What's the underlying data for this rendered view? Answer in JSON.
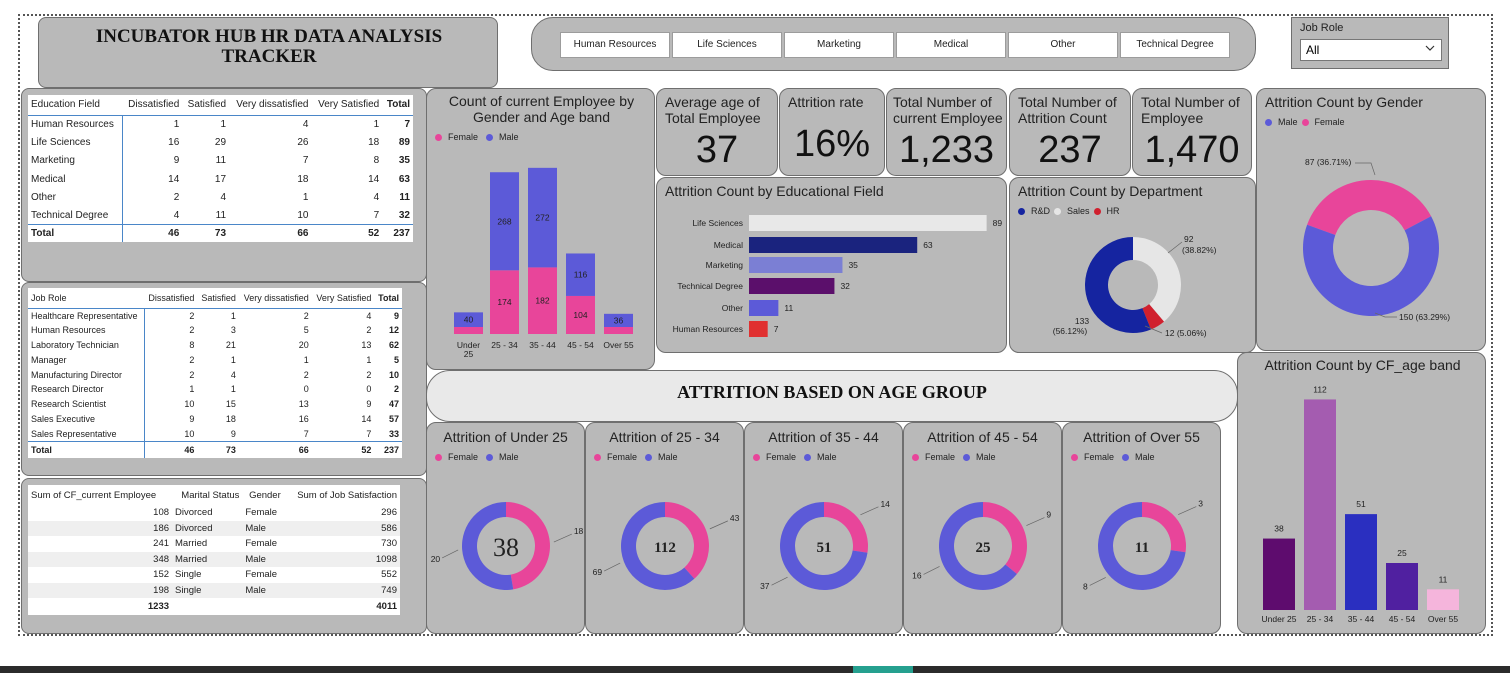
{
  "title": "INCUBATOR HUB HR DATA ANALYSIS TRACKER",
  "title_lines": [
    "INCUBATOR HUB HR DATA ANALYSIS",
    "TRACKER"
  ],
  "slicer": {
    "items": [
      "Human Resources",
      "Life Sciences",
      "Marketing",
      "Medical",
      "Other",
      "Technical Degree"
    ]
  },
  "job_role_filter": {
    "label": "Job Role",
    "value": "All",
    "icon": "chevron-down-icon"
  },
  "kpis": [
    {
      "label": "Average age of Total Employee",
      "value": "37"
    },
    {
      "label": "Attrition rate",
      "value": "16%"
    },
    {
      "label": "Total Number of current Employee",
      "value": "1,233"
    },
    {
      "label": "Total Number of Attrition Count",
      "value": "237"
    },
    {
      "label": "Total Number of Employee",
      "value": "1,470"
    }
  ],
  "edu_table": {
    "headers": [
      "Education Field",
      "Dissatisfied",
      "Satisfied",
      "Very dissatisfied",
      "Very Satisfied",
      "Total"
    ],
    "rows": [
      [
        "Human Resources",
        "1",
        "1",
        "4",
        "1",
        "7"
      ],
      [
        "Life Sciences",
        "16",
        "29",
        "26",
        "18",
        "89"
      ],
      [
        "Marketing",
        "9",
        "11",
        "7",
        "8",
        "35"
      ],
      [
        "Medical",
        "14",
        "17",
        "18",
        "14",
        "63"
      ],
      [
        "Other",
        "2",
        "4",
        "1",
        "4",
        "11"
      ],
      [
        "Technical Degree",
        "4",
        "11",
        "10",
        "7",
        "32"
      ]
    ],
    "total": [
      "Total",
      "46",
      "73",
      "66",
      "52",
      "237"
    ]
  },
  "job_table": {
    "headers": [
      "Job Role",
      "Dissatisfied",
      "Satisfied",
      "Very dissatisfied",
      "Very Satisfied",
      "Total"
    ],
    "rows": [
      [
        "Healthcare Representative",
        "2",
        "1",
        "2",
        "4",
        "9"
      ],
      [
        "Human Resources",
        "2",
        "3",
        "5",
        "2",
        "12"
      ],
      [
        "Laboratory Technician",
        "8",
        "21",
        "20",
        "13",
        "62"
      ],
      [
        "Manager",
        "2",
        "1",
        "1",
        "1",
        "5"
      ],
      [
        "Manufacturing Director",
        "2",
        "4",
        "2",
        "2",
        "10"
      ],
      [
        "Research Director",
        "1",
        "1",
        "0",
        "0",
        "2"
      ],
      [
        "Research Scientist",
        "10",
        "15",
        "13",
        "9",
        "47"
      ],
      [
        "Sales Executive",
        "9",
        "18",
        "16",
        "14",
        "57"
      ],
      [
        "Sales Representative",
        "10",
        "9",
        "7",
        "7",
        "33"
      ]
    ],
    "total": [
      "Total",
      "46",
      "73",
      "66",
      "52",
      "237"
    ]
  },
  "marital_table": {
    "headers": [
      "Sum of CF_current Employee",
      "Marital Status",
      "Gender",
      "Sum of Job Satisfaction"
    ],
    "rows": [
      [
        "108",
        "Divorced",
        "Female",
        "296"
      ],
      [
        "186",
        "Divorced",
        "Male",
        "586"
      ],
      [
        "241",
        "Married",
        "Female",
        "730"
      ],
      [
        "348",
        "Married",
        "Male",
        "1098"
      ],
      [
        "152",
        "Single",
        "Female",
        "552"
      ],
      [
        "198",
        "Single",
        "Male",
        "749"
      ]
    ],
    "total": [
      "1233",
      "",
      "",
      "4011"
    ]
  },
  "colors": {
    "female": "#e8459a",
    "male": "#5c5ad8",
    "panel": "#b9b9b9"
  },
  "banner": "ATTRITION BASED ON AGE GROUP",
  "chart_data": [
    {
      "type": "bar",
      "title": "Count of current Employee by Gender and Age band",
      "stacked": true,
      "categories": [
        "Under 25",
        "25 - 34",
        "35 - 44",
        "45 - 54",
        "Over 55"
      ],
      "series": [
        {
          "name": "Female",
          "values": [
            null,
            174,
            182,
            104,
            null
          ]
        },
        {
          "name": "Male",
          "values": [
            40,
            268,
            272,
            116,
            36
          ]
        }
      ],
      "legend": [
        "Female",
        "Male"
      ]
    },
    {
      "type": "bar",
      "orientation": "horizontal",
      "title": "Attrition Count by Educational Field",
      "categories": [
        "Life Sciences",
        "Medical",
        "Marketing",
        "Technical Degree",
        "Other",
        "Human Resources"
      ],
      "values": [
        89,
        63,
        35,
        32,
        11,
        7
      ],
      "colors": [
        "#e8e8e8",
        "#1a237e",
        "#7b7fd4",
        "#5b0f6b",
        "#5c5ad8",
        "#e03030"
      ]
    },
    {
      "type": "pie",
      "title": "Attrition Count by Department",
      "legend": [
        "R&D",
        "Sales",
        "HR"
      ],
      "values": [
        133,
        92,
        12
      ],
      "labels": [
        "133\n(56.12%)",
        "92\n(38.82%)",
        "12 (5.06%)"
      ],
      "colors": [
        "#1524a0",
        "#e6e6e6",
        "#d0202e"
      ]
    },
    {
      "type": "pie",
      "title": "Attrition Count by Gender",
      "legend": [
        "Male",
        "Female"
      ],
      "values": [
        150,
        87
      ],
      "labels": [
        "150 (63.29%)",
        "87 (36.71%)"
      ],
      "colors": [
        "#5c5ad8",
        "#e8459a"
      ]
    },
    {
      "type": "pie",
      "title": "Attrition of Under 25",
      "legend": [
        "Female",
        "Male"
      ],
      "center": "38",
      "values": [
        18,
        20
      ],
      "labels": [
        "18",
        "20"
      ]
    },
    {
      "type": "pie",
      "title": "Attrition of 25 - 34",
      "legend": [
        "Female",
        "Male"
      ],
      "center": "112",
      "values": [
        43,
        69
      ],
      "labels": [
        "43",
        "69"
      ]
    },
    {
      "type": "pie",
      "title": "Attrition of 35 - 44",
      "legend": [
        "Female",
        "Male"
      ],
      "center": "51",
      "values": [
        14,
        37
      ],
      "labels": [
        "14",
        "37"
      ]
    },
    {
      "type": "pie",
      "title": "Attrition of 45 - 54",
      "legend": [
        "Female",
        "Male"
      ],
      "center": "25",
      "values": [
        9,
        16
      ],
      "labels": [
        "9",
        "16"
      ]
    },
    {
      "type": "pie",
      "title": "Attrition of Over 55",
      "legend": [
        "Female",
        "Male"
      ],
      "center": "11",
      "values": [
        3,
        8
      ],
      "labels": [
        "3",
        "8"
      ]
    },
    {
      "type": "bar",
      "title": "Attrition Count by CF_age band",
      "categories": [
        "Under 25",
        "25 - 34",
        "35 - 44",
        "45 - 54",
        "Over 55"
      ],
      "values": [
        38,
        112,
        51,
        25,
        11
      ],
      "colors": [
        "#5e0c6e",
        "#a45cb0",
        "#2a2fc0",
        "#5020a0",
        "#f5b5dc"
      ]
    }
  ]
}
